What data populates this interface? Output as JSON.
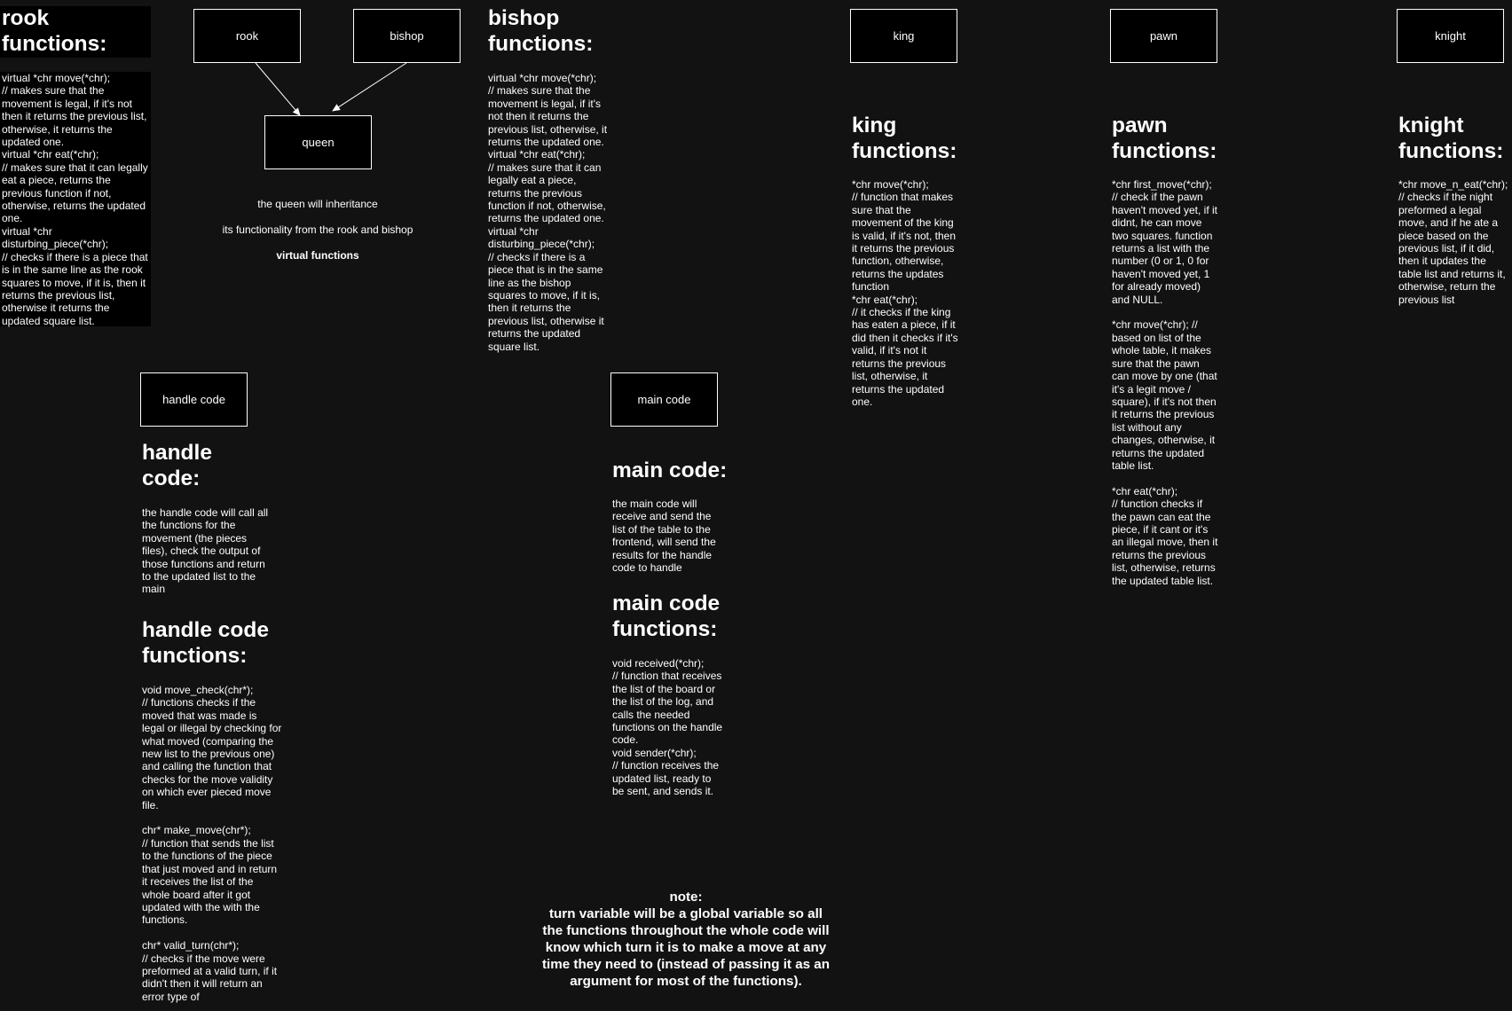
{
  "nodes": {
    "rook": "rook",
    "bishop": "bishop",
    "queen": "queen",
    "king": "king",
    "pawn": "pawn",
    "knight": "knight",
    "handle": "handle code",
    "main": "main code"
  },
  "rook": {
    "title": "rook\nfunctions:",
    "body": "virtual *chr move(*chr);\n// makes sure that the\nmovement is legal, if it's not\nthen it returns the previous list,\notherwise, it returns the\nupdated one.\nvirtual *chr eat(*chr);\n// makes sure that it can legally\neat a piece, returns the\nprevious function if not,\notherwise, returns the updated\none.\nvirtual *chr\ndisturbing_piece(*chr);\n// checks if there is a piece that\nis in the same line as the rook\nsquares to move, if it is, then it\nreturns the previous list,\notherwise it returns the\nupdated square list."
  },
  "bishop": {
    "title": "bishop\nfunctions:",
    "body": "virtual *chr move(*chr);\n// makes sure that the\nmovement is legal, if it's\nnot then it returns the\nprevious list, otherwise, it\nreturns the updated one.\nvirtual *chr eat(*chr);\n// makes sure that it can\nlegally eat a piece,\nreturns the previous\nfunction if not, otherwise,\nreturns the updated one.\nvirtual *chr\ndisturbing_piece(*chr);\n// checks if there is a\npiece that is in the same\nline as the bishop\nsquares to move, if it is,\nthen it returns the\nprevious list, otherwise it\nreturns the updated\nsquare list."
  },
  "queen_note": {
    "line1": "the queen will inheritance",
    "line2": "its functionality from the rook and bishop",
    "line3": "virtual functions"
  },
  "king": {
    "title": "king\nfunctions:",
    "body": "*chr move(*chr);\n// function that makes\nsure that the\nmovement of the king\nis valid, if it's not, then\nit returns the previous\nfunction, otherwise,\nreturns the updates\nfunction\n*chr eat(*chr);\n// it checks if the king\nhas eaten a piece, if it\ndid then it checks if it's\nvalid, if it's not it\nreturns the previous\nlist, otherwise, it\nreturns the updated\none."
  },
  "pawn": {
    "title": "pawn\nfunctions:",
    "body": "*chr first_move(*chr);\n// check if the pawn\nhaven't moved yet, if it\ndidnt, he can move\ntwo squares. function\nreturns a list with the\nnumber (0 or 1, 0 for\nhaven't moved yet, 1\nfor already moved)\nand NULL.\n\n*chr move(*chr); //\nbased on list of the\nwhole table, it makes\nsure that the pawn\ncan move by one (that\nit's a legit move /\nsquare), if it's not then\nit returns the previous\nlist without any\nchanges, otherwise, it\nreturns the updated\ntable list.\n\n*chr eat(*chr);\n// function checks if\nthe pawn can eat the\npiece, if it cant or it's\nan illegal move, then it\nreturns the previous\nlist, otherwise, returns\nthe updated table list."
  },
  "knight": {
    "title": "knight\nfunctions:",
    "body": "*chr move_n_eat(*chr);\n// checks if the night\npreformed a legal\nmove, and if he ate a\npiece based on the\nprevious list, if it did,\nthen it updates the\ntable list and returns it,\notherwise, return the\nprevious list"
  },
  "handle": {
    "title": "handle\ncode:",
    "body": "the handle code will call all\nthe functions for the\nmovement (the pieces\nfiles), check the output of\nthose functions and return\nto the updated list to the\nmain",
    "fn_title": "handle code\nfunctions:",
    "fn_body": "void move_check(chr*);\n// functions checks if the\nmoved that was made is\nlegal or illegal by checking for\nwhat moved (comparing the\nnew list to the previous one)\nand calling the function that\nchecks for the move validity\non which ever pieced move\nfile.\n\nchr* make_move(chr*);\n// function that sends the list\nto the functions of the piece\nthat just moved and in return\nit receives the list of the\nwhole board after it got\nupdated with the with the\nfunctions.\n\nchr* valid_turn(chr*);\n// checks if the move were\npreformed at a valid turn, if it\ndidn't then it will return an\nerror type of"
  },
  "main": {
    "title": "main code:",
    "body": "the main code will\nreceive and send the\nlist of the table to the\nfrontend, will send the\nresults for the handle\ncode to handle",
    "fn_title": "main code\nfunctions:",
    "fn_body": "void received(*chr);\n// function that receives\nthe list of the board or\nthe list of the log, and\ncalls the needed\nfunctions on the handle\ncode.\nvoid sender(*chr);\n// function receives the\nupdated list, ready to\nbe sent, and sends it."
  },
  "note": {
    "text": "note:\nturn variable will be a global variable so all\nthe functions throughout the whole code will\nknow which turn it is to make a move at any\ntime they need to (instead of passing it as an\nargument for most of the functions)."
  },
  "colors": {
    "background": "#121212",
    "node_fill": "#000000",
    "stroke": "#ffffff",
    "text": "#ffffff"
  }
}
